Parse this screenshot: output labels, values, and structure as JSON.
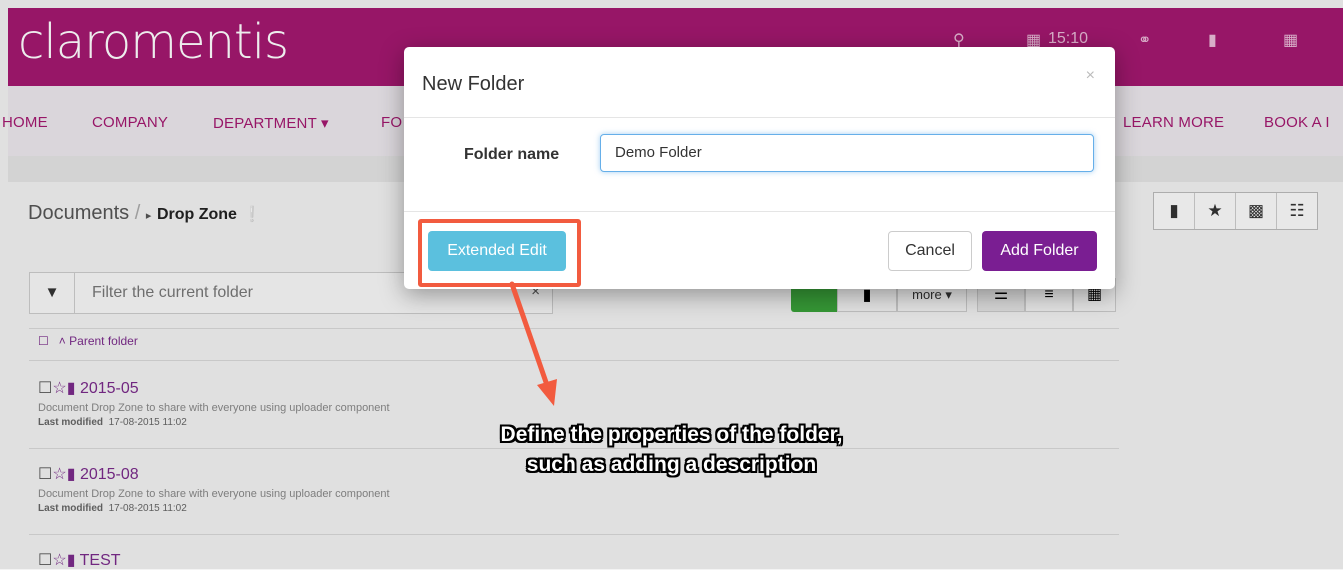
{
  "app": {
    "logo": "claromentis",
    "time": "15:10"
  },
  "nav": {
    "items": [
      "HOME",
      "COMPANY",
      "DEPARTMENT ▾",
      "FO",
      "LEARN MORE",
      "BOOK A I"
    ]
  },
  "breadcrumb": {
    "root": "Documents",
    "separator": "/",
    "current": "Drop Zone"
  },
  "filter": {
    "placeholder": "Filter the current folder",
    "clear": "×"
  },
  "view": {
    "more": "more ▾"
  },
  "list": {
    "parent_label": "Parent folder",
    "items": [
      {
        "name": "2015-05",
        "description": "Document Drop Zone to share with everyone using uploader component",
        "modified_label": "Last modified",
        "modified_value": "17-08-2015 11:02"
      },
      {
        "name": "2015-08",
        "description": "Document Drop Zone to share with everyone using uploader component",
        "modified_label": "Last modified",
        "modified_value": "17-08-2015 11:02"
      },
      {
        "name": "TEST"
      }
    ]
  },
  "modal": {
    "title": "New Folder",
    "close": "×",
    "field_label": "Folder name",
    "field_value": "Demo Folder",
    "extended_edit": "Extended Edit",
    "cancel": "Cancel",
    "add_folder": "Add Folder"
  },
  "annotation": {
    "line1": "Define the properties of the folder,",
    "line2": "such as adding a description"
  },
  "colors": {
    "brand": "#a3186f",
    "accent": "#7a1e92",
    "info": "#5bc0de",
    "annotation": "#f25b3f"
  }
}
